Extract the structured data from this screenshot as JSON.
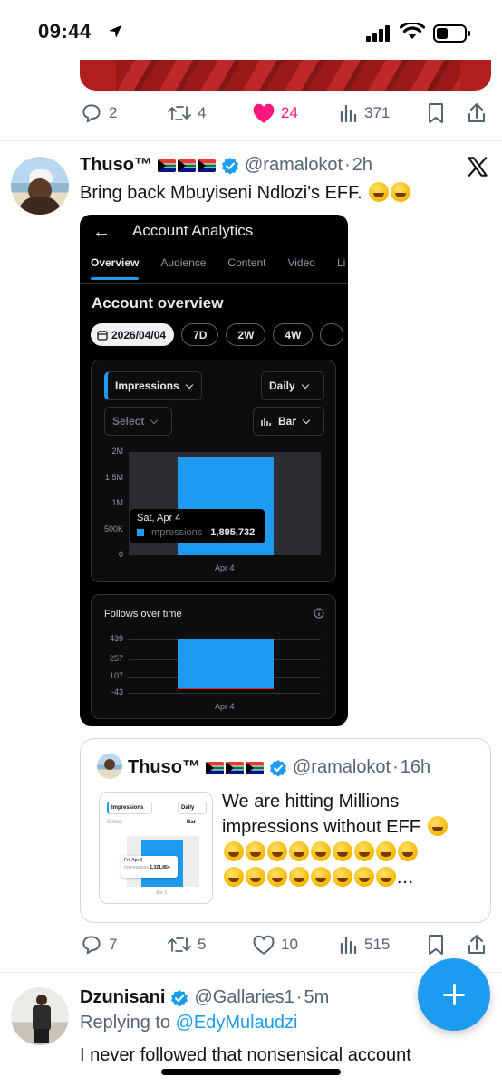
{
  "status_bar": {
    "time": "09:44"
  },
  "prev_tweet": {
    "replies": "2",
    "retweets": "4",
    "likes": "24",
    "views": "371"
  },
  "tweet": {
    "author": "Thuso™",
    "handle": "@ramalokot",
    "time": "2h",
    "text": "Bring back Mbuyiseni Ndlozi's EFF.",
    "replies": "7",
    "retweets": "5",
    "likes": "10",
    "views": "515"
  },
  "analytics": {
    "title": "Account Analytics",
    "tabs": [
      "Overview",
      "Audience",
      "Content",
      "Video",
      "Li"
    ],
    "section_title": "Account overview",
    "chips": [
      "2026/04/04",
      "7D",
      "2W",
      "4W"
    ],
    "metric_select": "Impressions",
    "period_select": "Daily",
    "compare_select": "Select",
    "chart_type_select": "Bar",
    "follows_title": "Follows over time"
  },
  "chart_data": [
    {
      "type": "bar",
      "categories": [
        "Apr 4"
      ],
      "series": [
        {
          "name": "Impressions",
          "values": [
            1895732
          ]
        }
      ],
      "yticks": [
        "2M",
        "1.5M",
        "1M",
        "500K",
        "0"
      ],
      "ylim": [
        0,
        2000000
      ],
      "tooltip": {
        "date": "Sat, Apr 4",
        "label": "Impressions",
        "value": "1,895,732"
      }
    },
    {
      "type": "bar",
      "title": "Follows over time",
      "categories": [
        "Apr 4"
      ],
      "yticks": [
        "439",
        "257",
        "107",
        "-43"
      ],
      "ylim": [
        -43,
        439
      ],
      "series": [
        {
          "values": [
            439
          ]
        },
        {
          "values": [
            -43
          ]
        }
      ]
    }
  ],
  "quote": {
    "author": "Thuso™",
    "handle": "@ramalokot",
    "time": "16h",
    "text": "We are hitting Millions impressions without EFF",
    "thumb": {
      "metric": "Impressions",
      "period": "Daily",
      "select": "Select",
      "bar": "Bar",
      "date": "Fri, Apr 3",
      "label": "Impressions",
      "value": "1,321,854",
      "xlabel": "Apr 3"
    }
  },
  "reply": {
    "author": "Dzunisani",
    "handle": "@Gallaries1",
    "time": "5m",
    "replying_label": "Replying to",
    "replying_to": "@EdyMulaudzi",
    "text": "I never followed that nonsensical account"
  },
  "colors": {
    "accent": "#1d9bf0",
    "like": "#f91880",
    "dark_bg": "#000000"
  }
}
